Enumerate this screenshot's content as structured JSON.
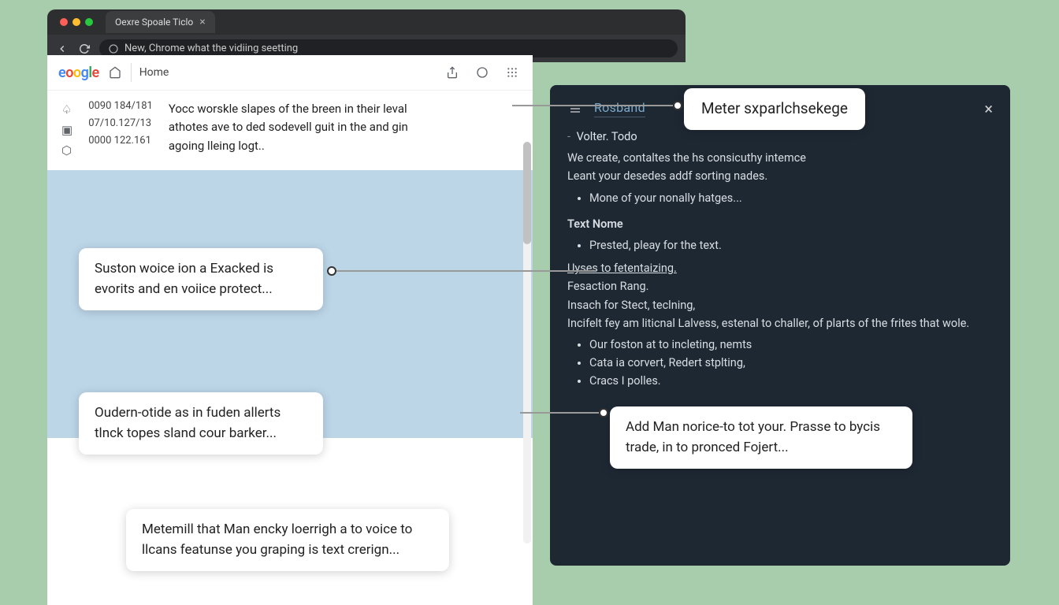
{
  "browser": {
    "tab_title": "Oexre Spoale Ticlo",
    "address": "New, Chrome what the vidiing seetting"
  },
  "header": {
    "home_label": "Home"
  },
  "meta": {
    "ids": [
      "0090 184/181",
      "07/10.127/13",
      "0000 122.161"
    ],
    "summary": "Yocc worskle slapes of the breen in their leval athotes ave to ded sodevell guit in the and gin agoing lleing logt.."
  },
  "callouts": {
    "c1": "Suston woice ion a Exacked is evorits and en voiice protect...",
    "c2": "Oudern-otide as in fuden allerts tlnck topes sland cour barker...",
    "c3": "Metemill that Man encky loerrigh a to voice to llcans featunse you graping is text crerign...",
    "c_search": "Meter sxparlchsekege",
    "c_panel": "Add Man norice-to tot your. Prasse to bycis trade, in to pronced Fojert..."
  },
  "panel": {
    "title": "Rosband",
    "sub": "Volter. Todo",
    "intro1": "We create, contaltes the hs consicuthy intemce",
    "intro2": "Leant your desedes addf sorting nades.",
    "bullet1": "Mone of your nonally hatges...",
    "text_nome": "Text Nome",
    "bullet2": "Prested, pleay for the text.",
    "line_a": "Uyses to fetentaizing.",
    "line_b": "Fesaction Rang.",
    "line_c": "Insach for Stect, teclning,",
    "line_d": "Incifelt fey am liticnal Lalvess, estenal to challer, of plarts of the frites that wole.",
    "sub_b1": "Our foston at to incleting, nemts",
    "sub_b2": "Cata ia corvert, Redert stplting,",
    "sub_b3": "Cracs I polles."
  }
}
